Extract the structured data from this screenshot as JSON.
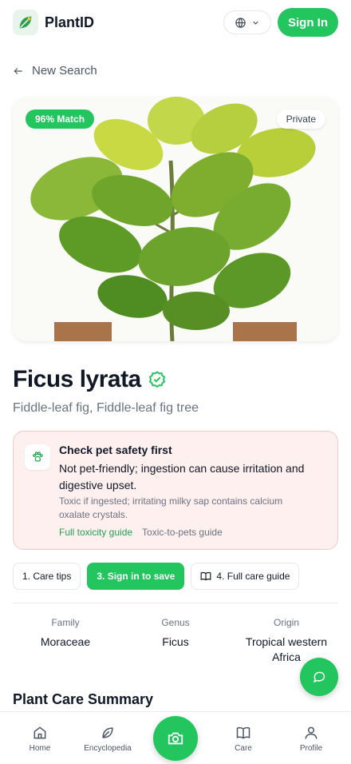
{
  "header": {
    "brand": "PlantID",
    "signin_label": "Sign In",
    "logo_icon": "leaf-logo-icon",
    "language_icon": "globe-icon"
  },
  "nav": {
    "back_label": "New Search"
  },
  "photo": {
    "match_badge": "96% Match",
    "privacy_badge": "Private"
  },
  "plant": {
    "name": "Ficus lyrata",
    "common_names": "Fiddle-leaf fig, Fiddle-leaf fig tree",
    "verified_icon": "verified-check-icon"
  },
  "pet_safety": {
    "heading": "Check pet safety first",
    "summary": "Not pet-friendly; ingestion can cause irritation and digestive upset.",
    "detail": "Toxic if ingested; irritating milky sap contains calcium oxalate crystals.",
    "link_toxicity": "Full toxicity guide",
    "link_pets": "Toxic-to-pets guide",
    "icon": "paw-icon"
  },
  "steps": [
    {
      "label": "1. Care tips"
    },
    {
      "label": "3. Sign in to save"
    },
    {
      "label": "4. Full care guide"
    }
  ],
  "taxonomy": [
    {
      "label": "Family",
      "value": "Moraceae"
    },
    {
      "label": "Genus",
      "value": "Ficus"
    },
    {
      "label": "Origin",
      "value": "Tropical western Africa"
    }
  ],
  "section": {
    "care_summary_title": "Plant Care Summary"
  },
  "bottom_nav": [
    {
      "label": "Home",
      "icon": "home-icon"
    },
    {
      "label": "Encyclopedia",
      "icon": "leaf-icon"
    },
    {
      "label": "Care",
      "icon": "book-icon"
    },
    {
      "label": "Profile",
      "icon": "user-icon"
    }
  ],
  "colors": {
    "accent": "#22c55e",
    "danger_bg": "#fdf0ef",
    "danger_border": "#f4c9c5"
  }
}
